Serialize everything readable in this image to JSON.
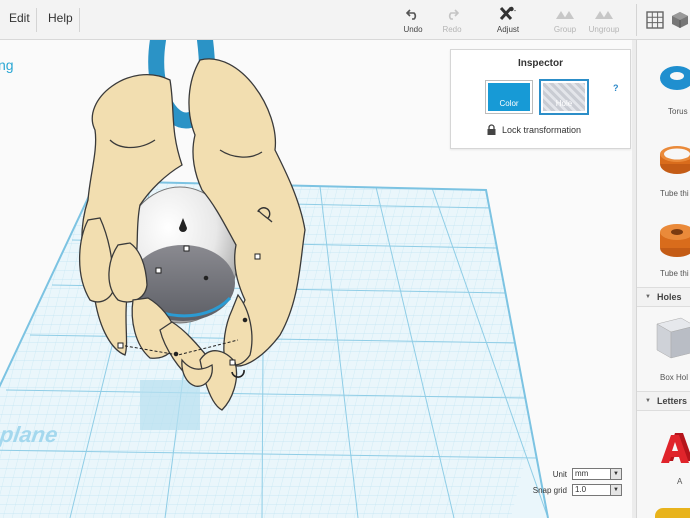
{
  "menu": {
    "edit": "Edit",
    "help": "Help"
  },
  "toolbar": {
    "undo": "Undo",
    "redo": "Redo",
    "adjust": "Adjust",
    "group": "Group",
    "ungroup": "Ungroup"
  },
  "canvas": {
    "partial_title": "ng",
    "workplane_label": "plane"
  },
  "inspector": {
    "title": "Inspector",
    "color_label": "Color",
    "hole_label": "Hole",
    "help": "?",
    "lock_label": "Lock transformation",
    "color_value": "#179ad6"
  },
  "grid_settings": {
    "unit_label": "Unit",
    "unit_value": "mm",
    "snap_label": "Snap grid",
    "snap_value": "1.0"
  },
  "shapes_panel": {
    "items": [
      {
        "label": "Torus",
        "icon": "torus-icon"
      },
      {
        "label": "Tube thi",
        "icon": "tube-thin-icon"
      },
      {
        "label": "Tube thi",
        "icon": "tube-thick-icon"
      }
    ],
    "holes_header": "Holes",
    "holes_items": [
      {
        "label": "Box Hol",
        "icon": "box-hole-icon"
      }
    ],
    "letters_header": "Letters",
    "letters_items": [
      {
        "label": "A",
        "icon": "letter-a-icon"
      }
    ]
  }
}
